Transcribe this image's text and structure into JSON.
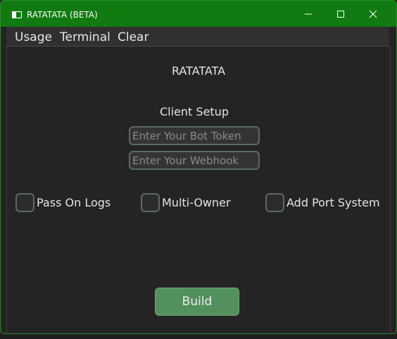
{
  "window": {
    "title": "RATATATA (BETA)",
    "icon": "app-window-icon",
    "controls": {
      "minimize": "minimize-icon",
      "maximize": "maximize-icon",
      "close": "close-icon"
    }
  },
  "menu": {
    "usage": "Usage",
    "terminal": "Terminal",
    "clear": "Clear"
  },
  "main": {
    "heading": "RATATATA",
    "setup_label": "Client Setup",
    "bot_token": {
      "value": "",
      "placeholder": "Enter Your Bot Token"
    },
    "webhook": {
      "value": "",
      "placeholder": "Enter Your Webhook"
    },
    "options": [
      {
        "label": "Pass On Logs",
        "checked": false
      },
      {
        "label": "Multi-Owner",
        "checked": false
      },
      {
        "label": "Add Port System",
        "checked": false
      }
    ],
    "build_label": "Build"
  },
  "colors": {
    "titlebar": "#117a11",
    "background": "#242424",
    "button": "#52915e",
    "field_border": "#5a6a64"
  }
}
